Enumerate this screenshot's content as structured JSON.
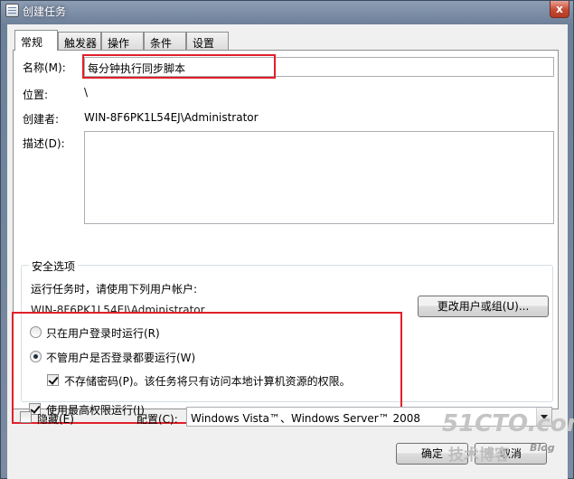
{
  "window": {
    "title": "创建任务",
    "close_glyph": "x"
  },
  "tabs": [
    {
      "label": "常规"
    },
    {
      "label": "触发器"
    },
    {
      "label": "操作"
    },
    {
      "label": "条件"
    },
    {
      "label": "设置"
    }
  ],
  "general": {
    "name_label": "名称(M):",
    "name_value": "每分钟执行同步脚本",
    "location_label": "位置:",
    "location_value": "\\",
    "author_label": "创建者:",
    "author_value": "WIN-8F6PK1L54EJ\\Administrator",
    "description_label": "描述(D):",
    "description_value": ""
  },
  "security": {
    "group_title": "安全选项",
    "run_as_label": "运行任务时，请使用下列用户帐户:",
    "run_as_user": "WIN-8F6PK1L54EJ\\Administrator",
    "change_user_button": "更改用户或组(U)...",
    "radio_logged_on": "只在用户登录时运行(R)",
    "radio_whether": "不管用户是否登录都要运行(W)",
    "radio_selected": "whether",
    "no_store_password": "不存储密码(P)。该任务将只有访问本地计算机资源的权限。",
    "no_store_password_checked": true,
    "highest_privileges": "使用最高权限运行(I)",
    "highest_privileges_checked": true
  },
  "bottom": {
    "hidden_label": "隐藏(E)",
    "hidden_checked": false,
    "configure_label": "配置(C):",
    "configure_value": "Windows Vista™、Windows Server™ 2008"
  },
  "buttons": {
    "ok": "确定",
    "cancel": "取消"
  },
  "watermark": {
    "site": "51CTO.com",
    "tagline": "技术博客",
    "blog": "Blog"
  },
  "colors": {
    "highlight_box": "#e0202a",
    "title_bar": "#7a8ba2"
  }
}
